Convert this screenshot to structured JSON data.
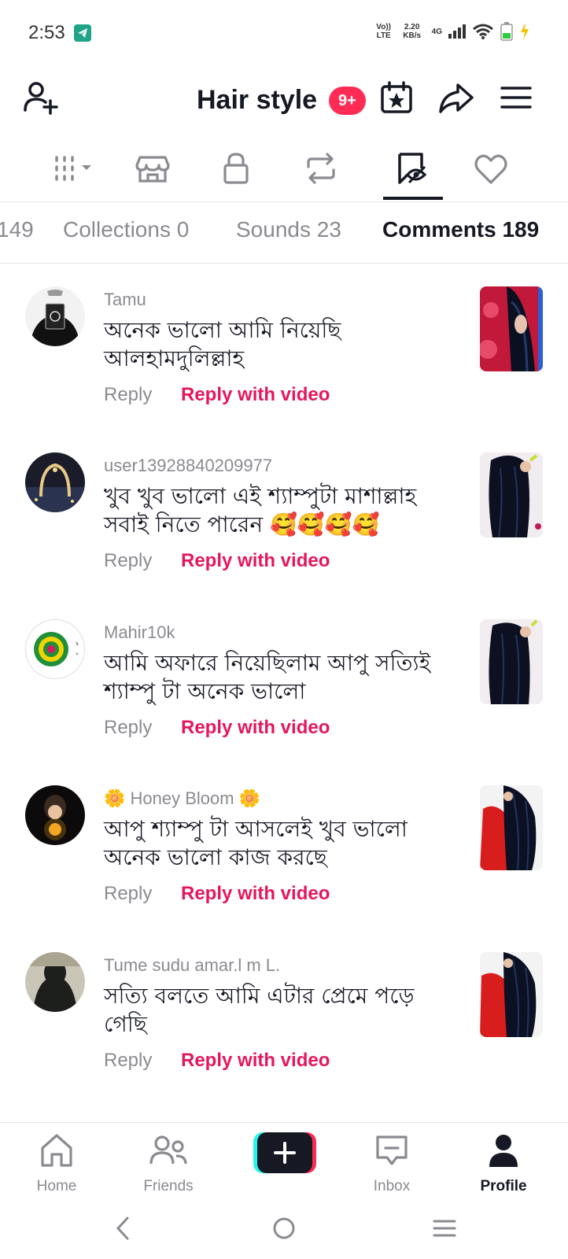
{
  "status_bar": {
    "time": "2:53",
    "volte": "Vo)) LTE",
    "net_speed": "2.20 KB/s",
    "network": "4G"
  },
  "header": {
    "title": "Hair style",
    "badge": "9+"
  },
  "sub_tabs": [
    {
      "label": "149"
    },
    {
      "label": "Collections 0"
    },
    {
      "label": "Sounds 23"
    },
    {
      "label": "Comments 189"
    }
  ],
  "comments": [
    {
      "name": "Tamu",
      "text": "অনেক ভালো আমি নিয়েছি আলহামদুলিল্লাহ",
      "reply": "Reply",
      "reply_video": "Reply with video"
    },
    {
      "name": "user13928840209977",
      "text": "খুব খুব ভালো এই শ্যাম্পুটা মাশাল্লাহ সবাই নিতে পারেন 🥰🥰🥰🥰",
      "reply": "Reply",
      "reply_video": "Reply with video"
    },
    {
      "name": "Mahir10k",
      "text": "আমি অফারে নিয়েছিলাম আপু সত্যিই শ্যাম্পু টা অনেক ভালো",
      "reply": "Reply",
      "reply_video": "Reply with video"
    },
    {
      "name": "🌼 Honey Bloom 🌼",
      "text": "আপু শ্যাম্পু টা আসলেই খুব ভালো অনেক ভালো কাজ করছে",
      "reply": "Reply",
      "reply_video": "Reply with video"
    },
    {
      "name": "Tume sudu amar.l m L.",
      "text": "সত্যি বলতে আমি এটার প্রেমে পড়ে গেছি",
      "reply": "Reply",
      "reply_video": "Reply with video"
    }
  ],
  "bottom_nav": {
    "home": "Home",
    "friends": "Friends",
    "inbox": "Inbox",
    "profile": "Profile"
  },
  "colors": {
    "accent": "#fe2c55",
    "reply_video": "#e5175c",
    "text": "#161823",
    "muted": "#8a8b91"
  }
}
